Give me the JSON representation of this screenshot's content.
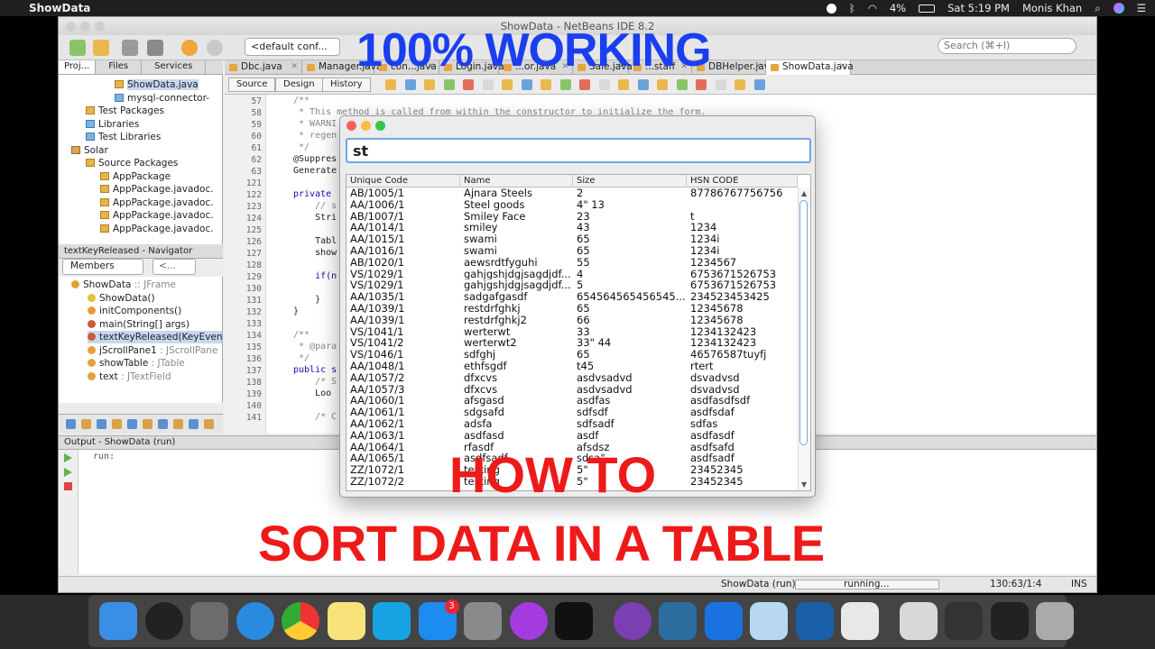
{
  "menubar": {
    "app_name": "ShowData",
    "time": "Sat 5:19 PM",
    "user": "Monis Khan",
    "battery": "4%"
  },
  "ide": {
    "window_title": "ShowData - NetBeans IDE 8.2",
    "config_select": "<default conf...",
    "search_placeholder": "Search (⌘+I)",
    "project_tabs": [
      "Proj...",
      "Files",
      "Services"
    ],
    "project_tree": [
      {
        "label": "ShowData.java",
        "indent": 3,
        "icon": "java"
      },
      {
        "label": "mysql-connector-",
        "indent": 3,
        "icon": "lib"
      },
      {
        "label": "Test Packages",
        "indent": 1,
        "icon": "pkg"
      },
      {
        "label": "Libraries",
        "indent": 1,
        "icon": "lib"
      },
      {
        "label": "Test Libraries",
        "indent": 1,
        "icon": "lib"
      },
      {
        "label": "Solar",
        "indent": 0,
        "icon": "src"
      },
      {
        "label": "Source Packages",
        "indent": 1,
        "icon": "pkg"
      },
      {
        "label": "AppPackage",
        "indent": 2,
        "icon": "pkg"
      },
      {
        "label": "AppPackage.javadoc.",
        "indent": 2,
        "icon": "pkg"
      },
      {
        "label": "AppPackage.javadoc.",
        "indent": 2,
        "icon": "pkg"
      },
      {
        "label": "AppPackage.javadoc.",
        "indent": 2,
        "icon": "pkg"
      },
      {
        "label": "AppPackage.javadoc.",
        "indent": 2,
        "icon": "pkg"
      }
    ],
    "navigator_title": "textKeyReleased - Navigator",
    "navigator_filter": "Members",
    "navigator_filter2": "<...",
    "navigator_items": [
      {
        "label": "ShowData",
        "suffix": " :: JFrame",
        "indent": 0
      },
      {
        "label": "ShowData()",
        "suffix": "",
        "indent": 1
      },
      {
        "label": "initComponents()",
        "suffix": "",
        "indent": 1
      },
      {
        "label": "main(String[] args)",
        "suffix": "",
        "indent": 1
      },
      {
        "label": "textKeyReleased(KeyEvent e",
        "suffix": "",
        "indent": 1,
        "selected": true
      },
      {
        "label": "jScrollPane1",
        "suffix": " : JScrollPane",
        "indent": 1
      },
      {
        "label": "showTable",
        "suffix": " : JTable",
        "indent": 1
      },
      {
        "label": "text",
        "suffix": " : JTextField",
        "indent": 1
      }
    ],
    "editor_tabs": [
      "Dbc.java",
      "Manager.java",
      "con...java",
      "Login.java",
      "...or.java",
      "Sale.java",
      "...staff",
      "DBHelper.java",
      "ShowData.java"
    ],
    "editor_modes": [
      "Source",
      "Design",
      "History"
    ],
    "line_numbers": [
      "57",
      "58",
      "59",
      "60",
      "61",
      "62",
      "63",
      "121",
      "122",
      "123",
      "124",
      "125",
      "126",
      "127",
      "128",
      "129",
      "130",
      "131",
      "132",
      "133",
      "134",
      "135",
      "136",
      "137",
      "138",
      "139",
      "140",
      "141"
    ],
    "code_lines": [
      "/**",
      " * This method is called from within the constructor to initialize the form.",
      " * WARNI",
      " * regen",
      " */",
      "@Suppres",
      "Generate",
      "",
      "private ",
      "    // s",
      "    Stri",
      "",
      "    Tabl",
      "    show",
      "",
      "    if(n",
      "",
      "    }",
      "}",
      "",
      "/**",
      " * @para",
      " */",
      "public s",
      "    /* S",
      "    Loo",
      "",
      "    /* C"
    ],
    "output_title": "Output - ShowData (run)",
    "output_text": "run:",
    "status": {
      "task": "ShowData (run)",
      "progress": "running...",
      "position": "130:63/1:4",
      "mode": "INS"
    }
  },
  "showdata_window": {
    "search_value": "st",
    "columns": [
      "Unique Code",
      "Name",
      "Size",
      "HSN CODE"
    ],
    "rows": [
      [
        "AB/1005/1",
        "Ajnara Steels",
        "2",
        "87786767756756"
      ],
      [
        "AA/1006/1",
        "Steel goods",
        "4\" 13",
        ""
      ],
      [
        "AB/1007/1",
        "Smiley Face",
        "23",
        "t"
      ],
      [
        "AA/1014/1",
        "smiley",
        "43",
        "1234"
      ],
      [
        "AA/1015/1",
        "swami",
        "65",
        "1234i"
      ],
      [
        "AA/1016/1",
        "swami",
        "65",
        "1234i"
      ],
      [
        "AB/1020/1",
        "aewsrdtfyguhi",
        "55",
        "1234567"
      ],
      [
        "VS/1029/1",
        "gahjgshjdgjsagdjdf...",
        "4",
        "6753671526753"
      ],
      [
        "VS/1029/1",
        "gahjgshjdgjsagdjdf...",
        "5",
        "6753671526753"
      ],
      [
        "AA/1035/1",
        "sadgafgasdf",
        "654564565456545...",
        "234523453425"
      ],
      [
        "AA/1039/1",
        "restdrfghkj",
        "65",
        "12345678"
      ],
      [
        "AA/1039/1",
        "restdrfghkj2",
        "66",
        "12345678"
      ],
      [
        "VS/1041/1",
        "werterwt",
        "33",
        "1234132423"
      ],
      [
        "VS/1041/2",
        "werterwt2",
        "33\" 44",
        "1234132423"
      ],
      [
        "VS/1046/1",
        "sdfghj",
        "65",
        "46576587tuyfj"
      ],
      [
        "AA/1048/1",
        "ethfsgdf",
        "t45",
        "rtert"
      ],
      [
        "AA/1057/2",
        "dfxcvs",
        "asdvsadvd",
        "dsvadvsd"
      ],
      [
        "AA/1057/3",
        "dfxcvs",
        "asdvsadvd",
        "dsvadvsd"
      ],
      [
        "AA/1060/1",
        "afsgasd",
        "asdfas",
        "asdfasdfsdf"
      ],
      [
        "AA/1061/1",
        "sdgsafd",
        "sdfsdf",
        "asdfsdaf"
      ],
      [
        "AA/1062/1",
        "adsfa",
        "sdfsadf",
        "sdfas"
      ],
      [
        "AA/1063/1",
        "asdfasd",
        "asdf",
        "asdfasdf"
      ],
      [
        "AA/1064/1",
        "rfasdf",
        "afsdsz",
        "asdfsafd"
      ],
      [
        "AA/1065/1",
        "asdfsadf",
        "sdsa\"",
        "asdfsadf"
      ],
      [
        "ZZ/1072/1",
        "testing",
        "5\"",
        "23452345"
      ],
      [
        "ZZ/1072/2",
        "testing",
        "5\"",
        "23452345"
      ]
    ]
  },
  "overlay": {
    "top_caption": "100% WORKING",
    "middle_caption": "HOW TO",
    "bottom_caption": "SORT DATA IN A TABLE",
    "top_color": "#1a3ff0",
    "caption_color": "#ee1a1a"
  },
  "dock": {
    "apps": [
      "finder-icon",
      "siri-icon",
      "launchpad-icon",
      "safari-icon",
      "chrome-icon",
      "notes-icon",
      "skype-icon",
      "appstore-icon",
      "system-preferences-icon",
      "podcasts-icon",
      "tv-icon",
      "github-icon",
      "mysql-workbench-icon",
      "teamviewer-icon",
      "virtualbox-icon",
      "quicktime-icon",
      "java-icon",
      "music-file-icon",
      "screenshot-icon",
      "terminal-icon",
      "trash-icon"
    ],
    "appstore_badge": "3"
  }
}
